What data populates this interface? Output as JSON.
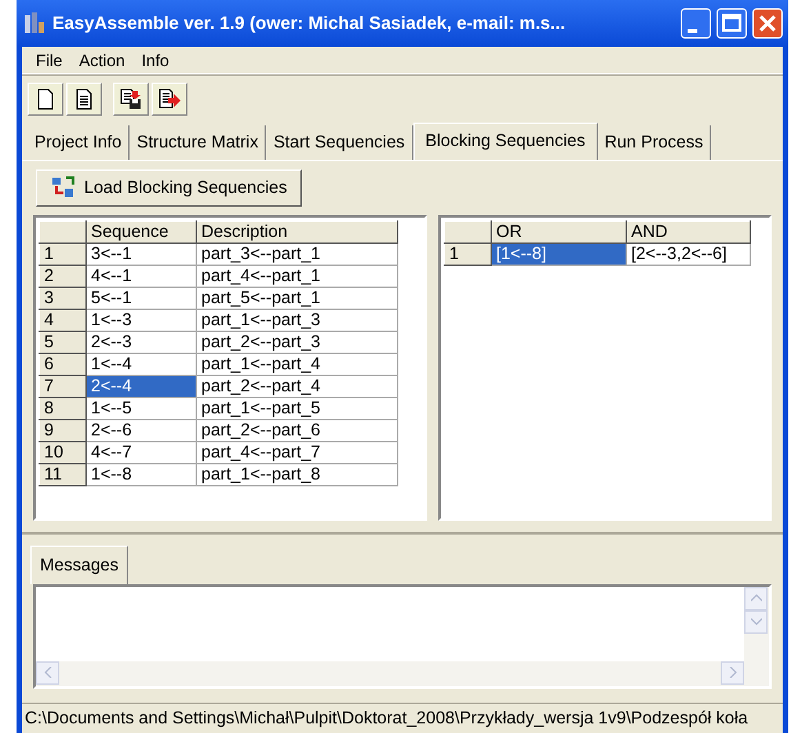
{
  "window": {
    "title": "EasyAssemble ver. 1.9 (ower: Michal Sasiadek, e-mail: m.s..."
  },
  "menu": [
    "File",
    "Action",
    "Info"
  ],
  "toolbar": [
    {
      "kind": "new"
    },
    {
      "kind": "open"
    },
    {
      "kind": "save"
    },
    {
      "kind": "export"
    }
  ],
  "tabs": [
    {
      "label": "Project Info",
      "selected": false
    },
    {
      "label": "Structure Matrix",
      "selected": false
    },
    {
      "label": "Start Sequencies",
      "selected": false
    },
    {
      "label": "Blocking Sequencies",
      "selected": true
    },
    {
      "label": "Run Process",
      "selected": false
    }
  ],
  "load_button": "Load Blocking Sequencies",
  "sequence_table": {
    "columns": [
      "Sequence",
      "Description"
    ],
    "rows": [
      {
        "index": "1",
        "sequence": "3<--1",
        "description": "part_3<--part_1",
        "selected": false
      },
      {
        "index": "2",
        "sequence": "4<--1",
        "description": "part_4<--part_1",
        "selected": false
      },
      {
        "index": "3",
        "sequence": "5<--1",
        "description": "part_5<--part_1",
        "selected": false
      },
      {
        "index": "4",
        "sequence": "1<--3",
        "description": "part_1<--part_3",
        "selected": false
      },
      {
        "index": "5",
        "sequence": "2<--3",
        "description": "part_2<--part_3",
        "selected": false
      },
      {
        "index": "6",
        "sequence": "1<--4",
        "description": "part_1<--part_4",
        "selected": false
      },
      {
        "index": "7",
        "sequence": "2<--4",
        "description": "part_2<--part_4",
        "selected": true
      },
      {
        "index": "8",
        "sequence": "1<--5",
        "description": "part_1<--part_5",
        "selected": false
      },
      {
        "index": "9",
        "sequence": "2<--6",
        "description": "part_2<--part_6",
        "selected": false
      },
      {
        "index": "10",
        "sequence": "4<--7",
        "description": "part_4<--part_7",
        "selected": false
      },
      {
        "index": "11",
        "sequence": "1<--8",
        "description": "part_1<--part_8",
        "selected": false
      }
    ]
  },
  "result_table": {
    "columns": [
      "OR",
      "AND"
    ],
    "rows": [
      {
        "index": "1",
        "or": "[1<--8]",
        "and": "[2<--3,2<--6]",
        "selected": true
      }
    ]
  },
  "messages_tab": "Messages",
  "status_bar": "C:\\Documents and Settings\\Michał\\Pulpit\\Doktorat_2008\\Przykłady_wersja 1v9\\Podzespół koła"
}
